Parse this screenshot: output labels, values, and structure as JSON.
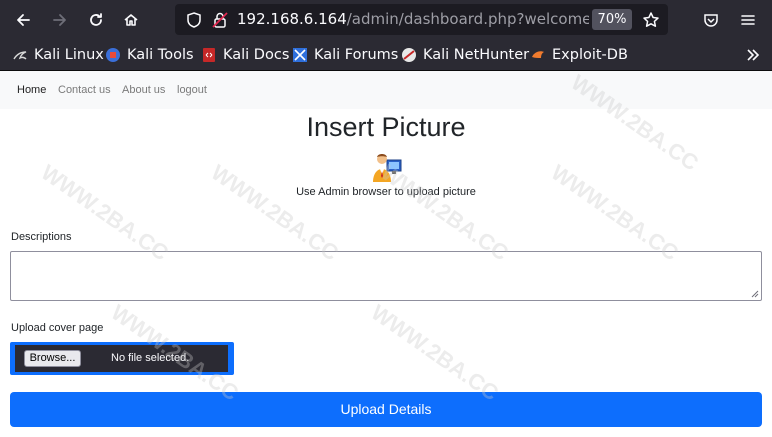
{
  "browser": {
    "url_host": "192.168.6.164",
    "url_path": "/admin/dashboard.php?welcome=ad",
    "zoom": "70%"
  },
  "bookmarks": [
    {
      "label": "Kali Linux",
      "icon": "kali-dragon-icon"
    },
    {
      "label": "Kali Tools",
      "icon": "kali-tools-icon"
    },
    {
      "label": "Kali Docs",
      "icon": "kali-docs-icon"
    },
    {
      "label": "Kali Forums",
      "icon": "kali-forums-icon"
    },
    {
      "label": "Kali NetHunter",
      "icon": "nethunter-icon"
    },
    {
      "label": "Exploit-DB",
      "icon": "exploitdb-icon"
    }
  ],
  "nav": {
    "home": "Home",
    "contact": "Contact us",
    "about": "About us",
    "logout": "logout"
  },
  "page": {
    "title": "Insert Picture",
    "subtitle": "Use Admin browser to upload picture",
    "descriptions_label": "Descriptions",
    "descriptions_value": "",
    "upload_label": "Upload cover page",
    "browse_label": "Browse...",
    "no_file": "No file selected.",
    "submit_label": "Upload Details"
  },
  "watermark": "WWW.2BA.CC",
  "colors": {
    "primary": "#0d6efd",
    "chrome": "#2b2a33",
    "navbar": "#f8f9fa"
  }
}
